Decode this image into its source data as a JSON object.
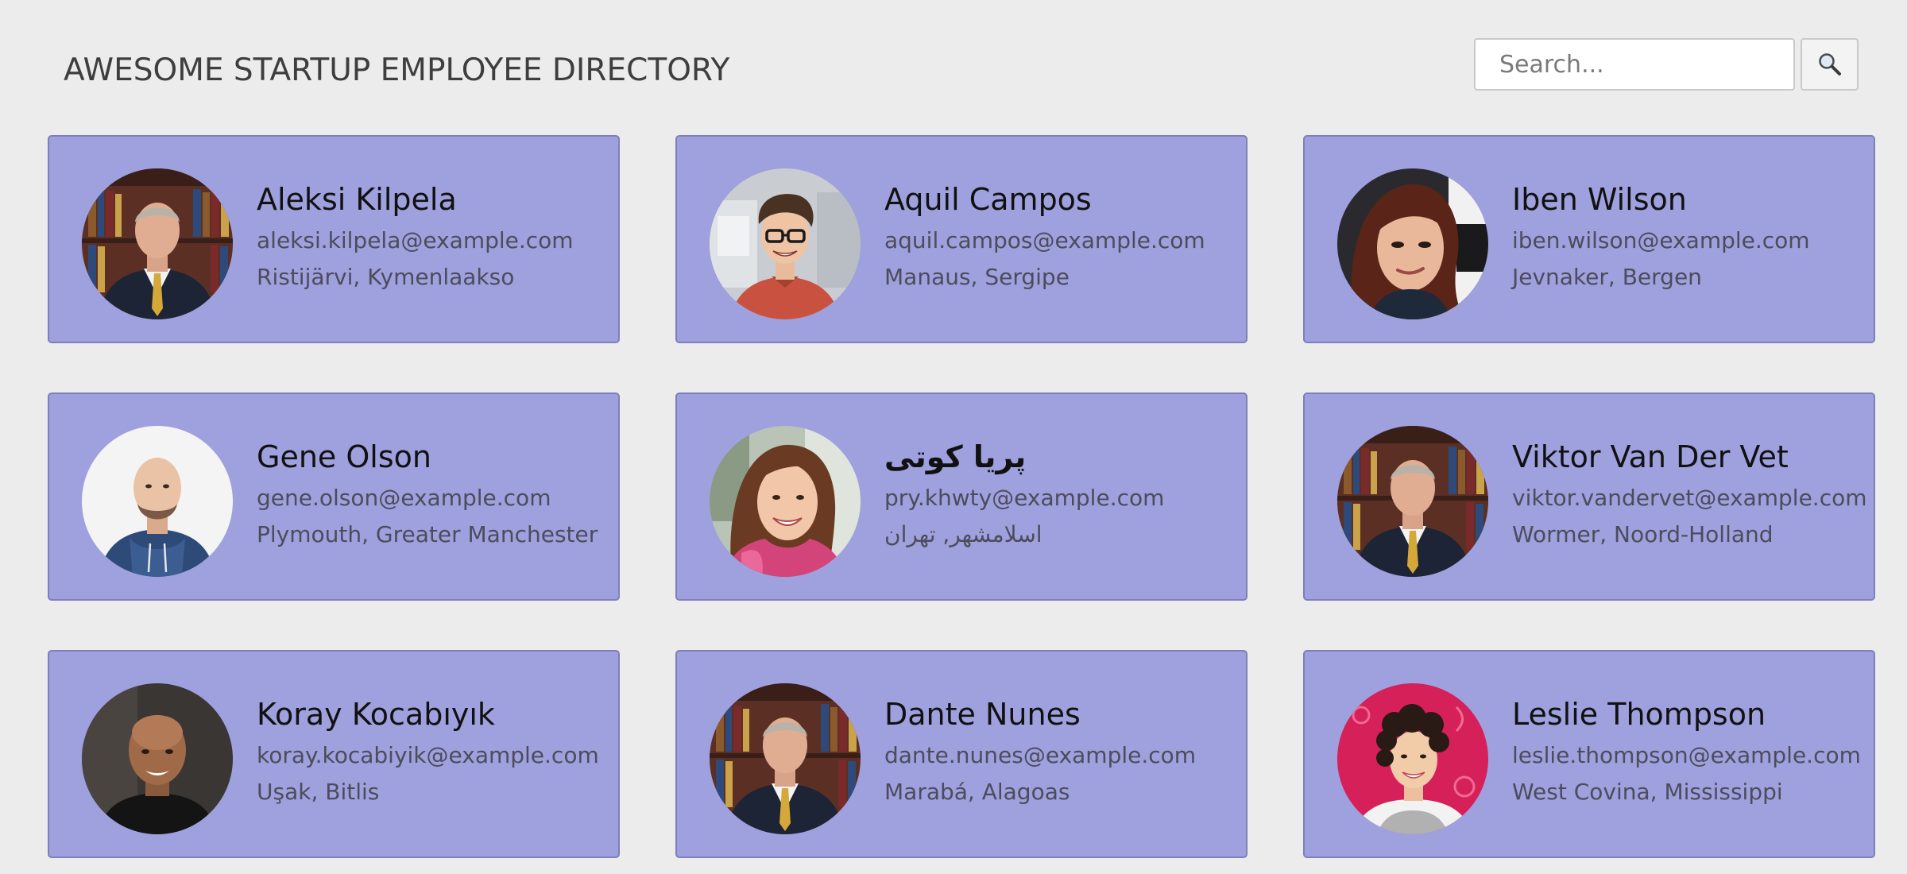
{
  "header": {
    "title": "AWESOME STARTUP EMPLOYEE DIRECTORY",
    "search_placeholder": "Search...",
    "search_icon": "magnifier-icon"
  },
  "employees": [
    {
      "name": "Aleksi Kilpela",
      "email": "aleksi.kilpela@example.com",
      "location": "Ristijärvi, Kymenlaakso",
      "avatar": "man-in-suit-photo"
    },
    {
      "name": "Aquil Campos",
      "email": "aquil.campos@example.com",
      "location": "Manaus, Sergipe",
      "avatar": "man-with-glasses-photo"
    },
    {
      "name": "Iben Wilson",
      "email": "iben.wilson@example.com",
      "location": "Jevnaker, Bergen",
      "avatar": "woman-selfie-photo"
    },
    {
      "name": "Gene Olson",
      "email": "gene.olson@example.com",
      "location": "Plymouth, Greater Manchester",
      "avatar": "bald-man-hoodie-photo"
    },
    {
      "name": "پریا کوتی",
      "email": "pry.khwty@example.com",
      "location": "اسلامشهر, تهران",
      "avatar": "smiling-woman-photo"
    },
    {
      "name": "Viktor Van Der Vet",
      "email": "viktor.vandervet@example.com",
      "location": "Wormer, Noord-Holland",
      "avatar": "man-in-suit-photo"
    },
    {
      "name": "Koray Kocabıyık",
      "email": "koray.kocabiyik@example.com",
      "location": "Uşak, Bitlis",
      "avatar": "bald-man-dark-photo"
    },
    {
      "name": "Dante Nunes",
      "email": "dante.nunes@example.com",
      "location": "Marabá, Alagoas",
      "avatar": "man-in-suit-photo"
    },
    {
      "name": "Leslie Thompson",
      "email": "leslie.thompson@example.com",
      "location": "West Covina, Mississippi",
      "avatar": "curly-hair-woman-photo"
    }
  ]
}
